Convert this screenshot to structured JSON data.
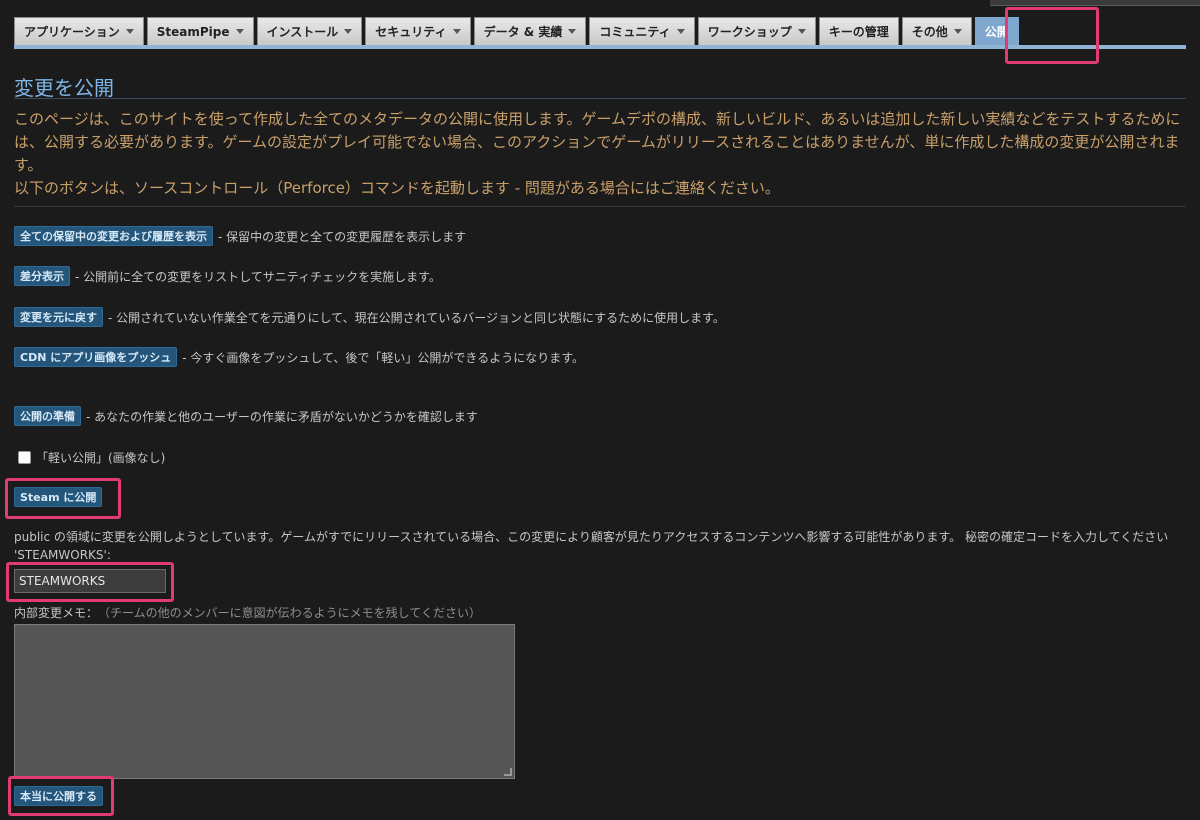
{
  "tabs": [
    {
      "label": "アプリケーション",
      "dropdown": true
    },
    {
      "label": "SteamPipe",
      "dropdown": true
    },
    {
      "label": "インストール",
      "dropdown": true
    },
    {
      "label": "セキュリティ",
      "dropdown": true
    },
    {
      "label": "データ & 実績",
      "dropdown": true
    },
    {
      "label": "コミュニティ",
      "dropdown": true
    },
    {
      "label": "ワークショップ",
      "dropdown": true
    },
    {
      "label": "キーの管理",
      "dropdown": false
    },
    {
      "label": "その他",
      "dropdown": true
    },
    {
      "label": "公開",
      "dropdown": false,
      "active": true
    }
  ],
  "page": {
    "title": "変更を公開",
    "intro1": "このページは、このサイトを使って作成した全てのメタデータの公開に使用します。ゲームデポの構成、新しいビルド、あるいは追加した新しい実績などをテストするためには、公開する必要があります。ゲームの設定がプレイ可能でない場合、このアクションでゲームがリリースされることはありませんが、単に作成した構成の変更が公開されます。",
    "intro2": "以下のボタンは、ソースコントロール（Perforce）コマンドを起動します - 問題がある場合にはご連絡ください。"
  },
  "actions": {
    "history": {
      "label": "全ての保留中の変更および履歴を表示",
      "desc": "- 保留中の変更と全ての変更履歴を表示します"
    },
    "diff": {
      "label": "差分表示",
      "desc": "- 公開前に全ての変更をリストしてサニティチェックを実施します。"
    },
    "revert": {
      "label": "変更を元に戻す",
      "desc": "- 公開されていない作業全てを元通りにして、現在公開されているバージョンと同じ状態にするために使用します。"
    },
    "cdn": {
      "label": "CDN にアプリ画像をプッシュ",
      "desc": "- 今すぐ画像をプッシュして、後で「軽い」公開ができるようになります。"
    },
    "prepare": {
      "label": "公開の準備",
      "desc": "- あなたの作業と他のユーザーの作業に矛盾がないかどうかを確認します"
    }
  },
  "light_publish": {
    "label": "「軽い公開」(画像なし)",
    "checked": false
  },
  "publish_button": "Steam に公開",
  "warning": "public の領域に変更を公開しようとしています。ゲームがすでにリリースされている場合、この変更により顧客が見たりアクセスするコンテンツへ影響する可能性があります。 秘密の確定コードを入力してください 'STEAMWORKS':",
  "confirm_code": "STEAMWORKS",
  "memo": {
    "label": "内部変更メモ：",
    "hint": "（チームの他のメンバーに意図が伝わるようにメモを残してください）",
    "value": ""
  },
  "final_button": "本当に公開する",
  "colors": {
    "highlight": "#e13b74",
    "accent": "#7fb4e6",
    "button": "#24557a",
    "intro": "#c9a06a"
  }
}
